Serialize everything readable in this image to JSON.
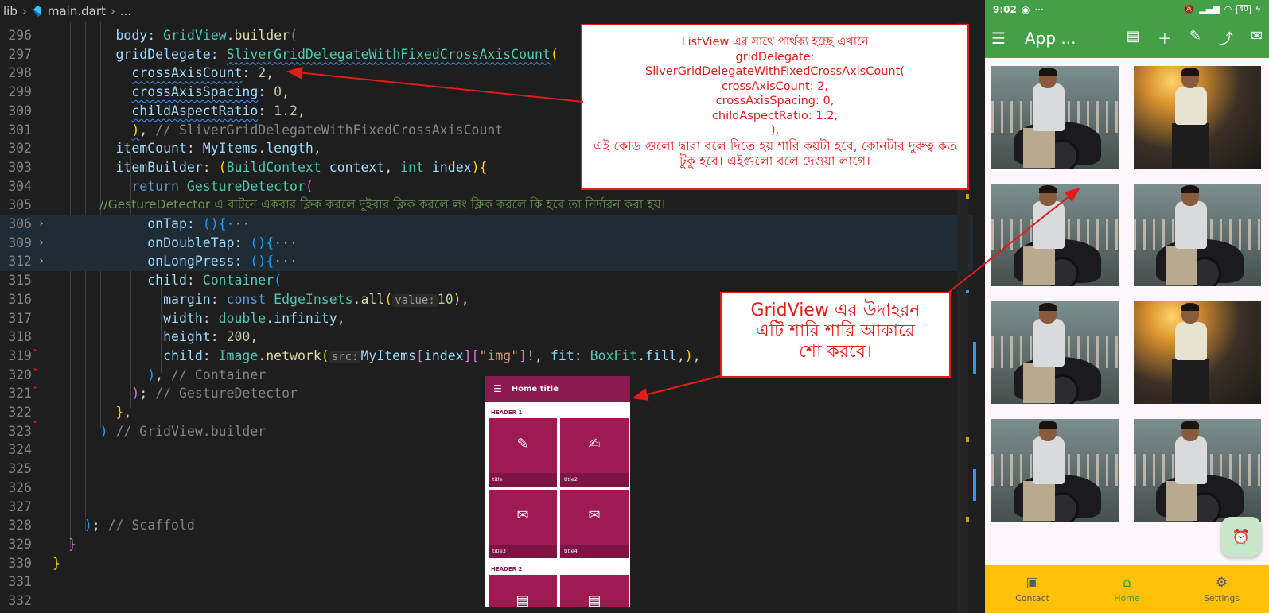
{
  "breadcrumb": {
    "root": "lib",
    "file": "main.dart",
    "more": "..."
  },
  "editor": {
    "lines": [
      {
        "n": "296"
      },
      {
        "n": "297"
      },
      {
        "n": "298"
      },
      {
        "n": "299"
      },
      {
        "n": "300"
      },
      {
        "n": "301"
      },
      {
        "n": "302"
      },
      {
        "n": "303"
      },
      {
        "n": "304"
      },
      {
        "n": "305"
      },
      {
        "n": "306"
      },
      {
        "n": "309"
      },
      {
        "n": "312"
      },
      {
        "n": "315"
      },
      {
        "n": "316"
      },
      {
        "n": "317"
      },
      {
        "n": "318"
      },
      {
        "n": "319"
      },
      {
        "n": "320"
      },
      {
        "n": "321"
      },
      {
        "n": "322"
      },
      {
        "n": "323"
      },
      {
        "n": "324"
      },
      {
        "n": "325"
      },
      {
        "n": "326"
      },
      {
        "n": "327"
      },
      {
        "n": "328"
      },
      {
        "n": "329"
      },
      {
        "n": "330"
      },
      {
        "n": "331"
      },
      {
        "n": "332"
      }
    ],
    "tokens": {
      "body": "body",
      "GridView": "GridView",
      "builder": "builder",
      "gridDelegate": "gridDelegate",
      "Sliver": "SliverGridDelegateWithFixedCrossAxisCount",
      "crossAxisCount": "crossAxisCount",
      "v2": "2",
      "crossAxisSpacing": "crossAxisSpacing",
      "v0": "0",
      "childAspectRatio": "childAspectRatio",
      "v12": "1.2",
      "cmtSliver": "// SliverGridDelegateWithFixedCrossAxisCount",
      "itemCount": "itemCount",
      "MyItems": "MyItems",
      "length": "length",
      "itemBuilder": "itemBuilder",
      "BuildContext": "BuildContext",
      "context": "context",
      "int": "int",
      "index": "index",
      "return": "return",
      "GestureDetector": "GestureDetector",
      "cmtGesture": "//GestureDetector এ বাটনে একবার ক্লিক করলে দুইবার ক্লিক করলে লং ক্লিক করলে কি হবে তা নির্দারন করা হয়।",
      "onTap": "onTap",
      "onDoubleTap": "onDoubleTap",
      "onLongPress": "onLongPress",
      "ellipsis": "···",
      "child": "child",
      "Container": "Container",
      "margin": "margin",
      "const": "const",
      "EdgeInsets": "EdgeInsets",
      "all": "all",
      "valueHint": "value:",
      "v10": "10",
      "width": "width",
      "double": "double",
      "infinity": "infinity",
      "height": "height",
      "v200": "200",
      "Image": "Image",
      "network": "network",
      "srcHint": "src:",
      "img": "\"img\"",
      "fit": "fit",
      "BoxFit": "BoxFit",
      "fill": "fill",
      "cmtContainer": "// Container",
      "cmtGestureEnd": "// GestureDetector",
      "cmtGridView": "// GridView.builder",
      "cmtScaffold": "// Scaffold"
    }
  },
  "annotations": {
    "box1": [
      "ListView এর সাথে পার্থক্য হচ্ছে এখানে",
      "gridDelegate:",
      "SliverGridDelegateWithFixedCrossAxisCount(",
      "crossAxisCount: 2,",
      "crossAxisSpacing: 0,",
      "childAspectRatio: 1.2,",
      "),",
      "এই কোড গুলো দ্বারা বলে দিতে হয় শারি কয়টা হবে, কোনটার দুরুত্ব কত টুকু হবে। এইগুলো বলে দেওয়া লাগে।"
    ],
    "box2": [
      "GridView এর উদাহরন",
      "এটি শারি শারি আকারে",
      "শো করবে।"
    ],
    "color": "#e21b1b"
  },
  "mini_app": {
    "title": "Home title",
    "header1": "HEADER 1",
    "header2": "HEADER 2",
    "tiles": [
      {
        "label": "title",
        "icon": "pencil-icon"
      },
      {
        "label": "title2",
        "icon": "edit-note-icon"
      },
      {
        "label": "title3",
        "icon": "envelope-hand-icon"
      },
      {
        "label": "title4",
        "icon": "mail-icon"
      }
    ],
    "accent": "#8a1a50"
  },
  "phone": {
    "status": {
      "time": "9:02",
      "battery": "40"
    },
    "appbar": {
      "title": "App ...",
      "color": "#43a047"
    },
    "nav": [
      {
        "label": "Contact",
        "icon": "contact-icon"
      },
      {
        "label": "Home",
        "icon": "home-icon",
        "selected": true
      },
      {
        "label": "Settings",
        "icon": "gear-icon"
      }
    ],
    "nav_color": "#ffc107",
    "photos": [
      "rider",
      "night",
      "rider",
      "rider",
      "rider",
      "night",
      "rider",
      "rider"
    ]
  }
}
